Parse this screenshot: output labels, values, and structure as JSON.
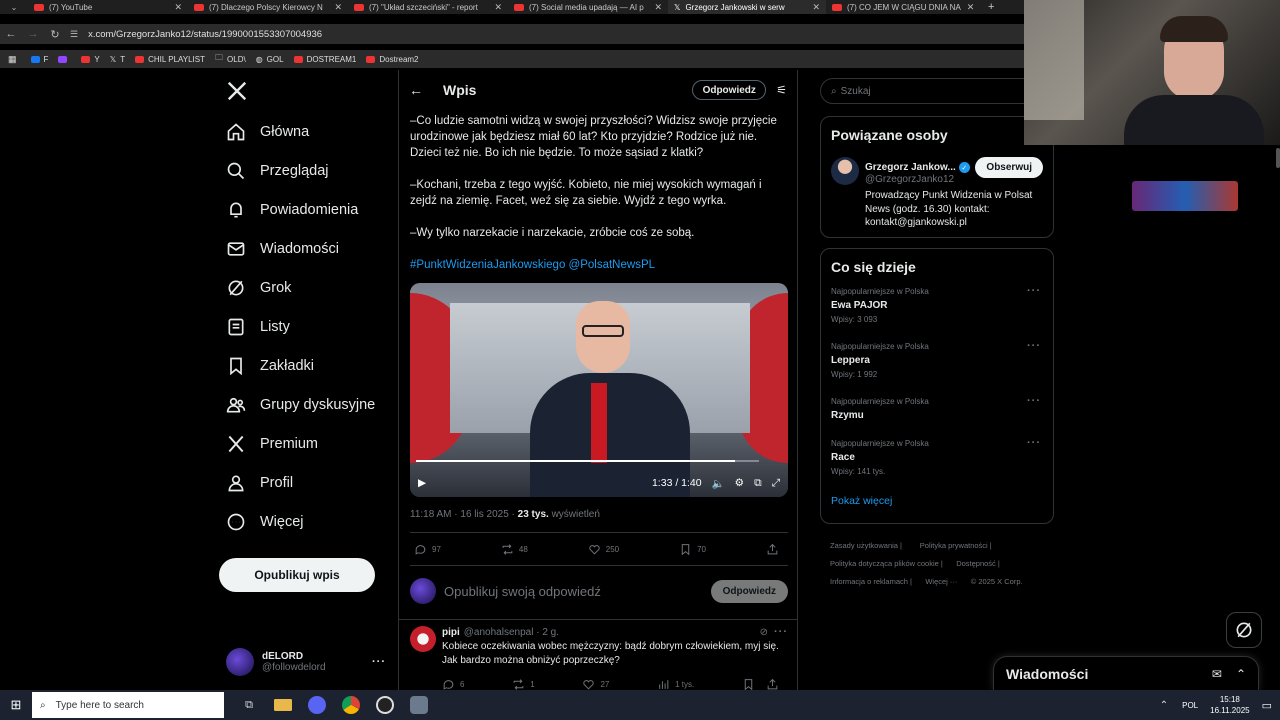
{
  "tabs": [
    {
      "label": "(7) YouTube",
      "active": false
    },
    {
      "label": "(7) Dlaczego Polscy Kierowcy N",
      "active": false
    },
    {
      "label": "(7) \"Układ szczeciński\" - report",
      "active": false
    },
    {
      "label": "(7) Social media upadają — AI p",
      "active": false
    },
    {
      "label": "Grzegorz Jankowski w serw",
      "active": true
    },
    {
      "label": "(7) CO JEM W CIĄGU DNIA NA",
      "active": false
    }
  ],
  "url": "x.com/GrzegorzJanko12/status/1990001553307004936",
  "bookmarks": [
    "F",
    "",
    "Y",
    "T",
    "CHIL PLAYLIST",
    "OLD\\",
    "GOL",
    "DOSTREAM1",
    "Dostream2"
  ],
  "sidebar": {
    "items": [
      "Główna",
      "Przeglądaj",
      "Powiadomienia",
      "Wiadomości",
      "Grok",
      "Listy",
      "Zakładki",
      "Grupy dyskusyjne",
      "Premium",
      "Profil",
      "Więcej"
    ],
    "post_button": "Opublikuj wpis",
    "account_name": "dELORD",
    "account_handle": "@followdelord"
  },
  "header": {
    "title": "Wpis",
    "reply_button": "Odpowiedz"
  },
  "post": {
    "para1": "–Co ludzie samotni widzą w swojej przyszłości? Widzisz swoje przyjęcie urodzinowe jak będziesz miał 60 lat? Kto przyjdzie? Rodzice już nie. Dzieci też nie. Bo ich nie będzie. To może sąsiad z klatki?",
    "para2": "–Kochani, trzeba z tego wyjść. Kobieto, nie miej wysokich wymagań i zejdź na ziemię. Facet, weź się za siebie. Wyjdź z tego wyrka.",
    "para3": "–Wy tylko narzekacie i narzekacie, zróbcie coś ze sobą.",
    "hashtag": "#PunktWidzeniaJankowskiego",
    "mention": "@PolsatNewsPL",
    "video_time": "1:33 / 1:40",
    "video_progress": 0.93,
    "timestamp": "11:18 AM · 16 lis 2025 · ",
    "views_count": "23 tys.",
    "views_label": " wyświetleń",
    "replies": "97",
    "reposts": "48",
    "likes": "250",
    "bookmarks": "70"
  },
  "reply_box": {
    "placeholder": "Opublikuj swoją odpowiedź",
    "button": "Odpowiedz"
  },
  "reply": {
    "name": "pipi",
    "handle": "@anohalsenpal · 2 g.",
    "text": "Kobiece oczekiwania wobec mężczyzny: bądź dobrym człowiekiem, myj się. Jak bardzo można obniżyć poprzeczkę?",
    "replies": "6",
    "reposts": "1",
    "likes": "27",
    "views": "1 tys."
  },
  "search": {
    "placeholder": "Szukaj"
  },
  "related": {
    "title": "Powiązane osoby",
    "name": "Grzegorz Jankow...",
    "handle": "@GrzegorzJanko12",
    "follow": "Obserwuj",
    "bio": "Prowadzący Punkt Widzenia w Polsat News (godz. 16.30) kontakt: kontakt@gjankowski.pl"
  },
  "trends": {
    "title": "Co się dzieje",
    "items": [
      {
        "meta": "Najpopularniejsze w Polska",
        "name": "Ewa PAJOR",
        "count": "Wpisy: 3 093"
      },
      {
        "meta": "Najpopularniejsze w Polska",
        "name": "Leppera",
        "count": "Wpisy: 1 992"
      },
      {
        "meta": "Najpopularniejsze w Polska",
        "name": "Rzymu",
        "count": ""
      },
      {
        "meta": "Najpopularniejsze w Polska",
        "name": "Race",
        "count": "Wpisy: 141 tys."
      }
    ],
    "more": "Pokaż więcej"
  },
  "footer": [
    "Zasady użytkowania |",
    "Polityka prywatności |",
    "Polityka dotycząca plików cookie |",
    "Dostępność |",
    "Informacja o reklamach |",
    "Więcej ···",
    "© 2025 X Corp."
  ],
  "messages_label": "Wiadomości",
  "taskbar": {
    "search_placeholder": "Type here to search",
    "lang": "POL",
    "time": "15:18",
    "date": "16.11.2025"
  },
  "colors": {
    "accent": "#1d9bf0",
    "background": "#000000",
    "border": "#2f3336"
  }
}
